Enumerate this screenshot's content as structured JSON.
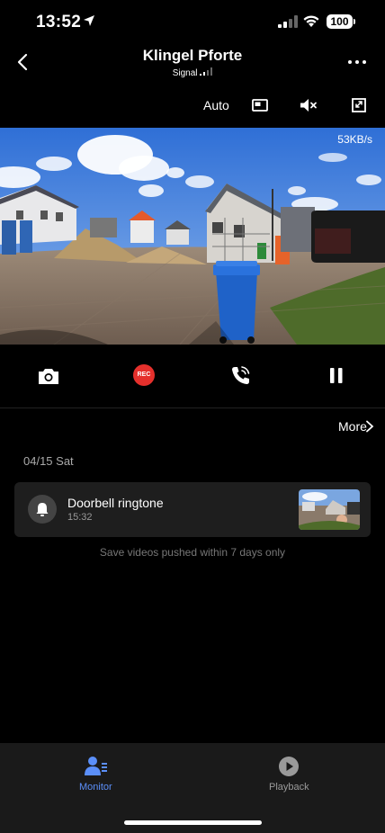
{
  "status_bar": {
    "time": "13:52",
    "battery": "100"
  },
  "header": {
    "title": "Klingel Pforte",
    "subtitle": "Signal"
  },
  "toolbar": {
    "quality": "Auto"
  },
  "video": {
    "rate": "53KB/s"
  },
  "controls": {
    "rec_label": "REC"
  },
  "events": {
    "more_label": "More",
    "date": "04/15 Sat",
    "items": [
      {
        "title": "Doorbell ringtone",
        "time": "15:32"
      }
    ],
    "note": "Save videos pushed within 7 days only"
  },
  "bottom_nav": {
    "items": [
      {
        "label": "Monitor",
        "active": true,
        "color": "#5b8ff9"
      },
      {
        "label": "Playback",
        "active": false,
        "color": "#9a9a9a"
      }
    ]
  },
  "colors": {
    "accent": "#5b8ff9",
    "rec": "#e5302c"
  },
  "icons": [
    "back-icon",
    "more-dots-icon",
    "picture-in-picture-icon",
    "mute-icon",
    "fullscreen-icon",
    "camera-icon",
    "phone-call-icon",
    "pause-icon",
    "chevron-right-icon",
    "bell-icon",
    "monitor-icon",
    "play-icon"
  ]
}
